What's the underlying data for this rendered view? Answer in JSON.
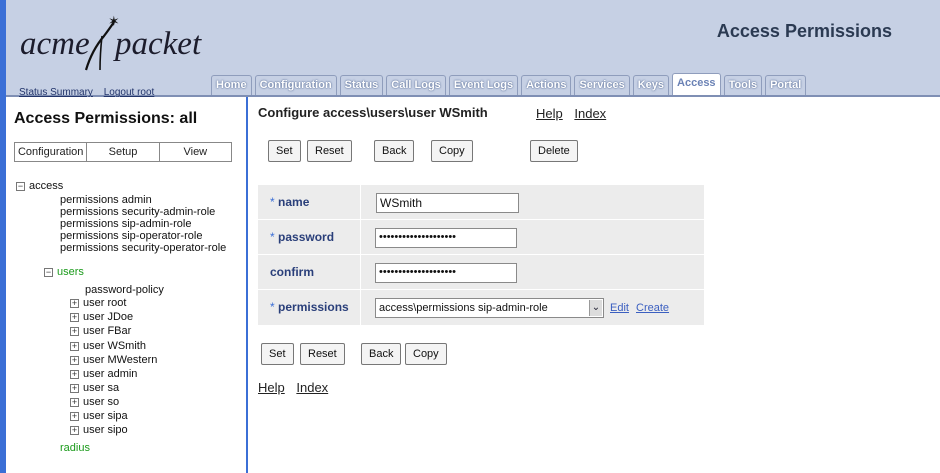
{
  "header": {
    "logo_part1": "acme",
    "logo_part2": "packet",
    "page_heading": "Access Permissions",
    "links": [
      "Status Summary",
      "Logout root"
    ],
    "tabs": [
      "Home",
      "Configuration",
      "Status",
      "Call Logs",
      "Event Logs",
      "Actions",
      "Services",
      "Keys",
      "Access",
      "Tools",
      "Portal"
    ],
    "active_tab": "Access"
  },
  "sidebar": {
    "title": "Access Permissions: all",
    "toggles": [
      "Configuration",
      "Setup",
      "View"
    ],
    "tree": [
      {
        "label": "access",
        "box": "−",
        "color": "black"
      },
      {
        "label": "permissions admin"
      },
      {
        "label": "permissions security-admin-role"
      },
      {
        "label": "permissions sip-admin-role"
      },
      {
        "label": "permissions sip-operator-role"
      },
      {
        "label": "permissions security-operator-role"
      },
      {
        "label": "users",
        "box": "−",
        "color": "green"
      },
      {
        "label": "password-policy"
      },
      {
        "label": "user root",
        "box": "+"
      },
      {
        "label": "user JDoe",
        "box": "+"
      },
      {
        "label": "user FBar",
        "box": "+"
      },
      {
        "label": "user WSmith",
        "box": "+",
        "selected": true
      },
      {
        "label": "user MWestern",
        "box": "+"
      },
      {
        "label": "user admin",
        "box": "+"
      },
      {
        "label": "user sa",
        "box": "+"
      },
      {
        "label": "user so",
        "box": "+"
      },
      {
        "label": "user sipa",
        "box": "+"
      },
      {
        "label": "user sipo",
        "box": "+"
      },
      {
        "label": "radius",
        "color": "green"
      }
    ]
  },
  "main": {
    "title": "Configure access\\users\\user WSmith",
    "title_links": [
      "Help",
      "Index"
    ],
    "buttons_top": [
      "Set",
      "Reset",
      "Back",
      "Copy",
      "Delete"
    ],
    "buttons_bottom": [
      "Set",
      "Reset",
      "Back",
      "Copy"
    ],
    "bottom_links": [
      "Help",
      "Index"
    ],
    "fields": {
      "name_label": "name",
      "name_value": "WSmith",
      "password_label": "password",
      "password_value": "••••••••••••••••••••",
      "confirm_label": "confirm",
      "confirm_value": "••••••••••••••••••••",
      "permissions_label": "permissions",
      "permissions_value": "access\\permissions sip-admin-role",
      "edit_link": "Edit",
      "create_link": "Create",
      "required_mark": "*"
    }
  },
  "colors": {
    "accent": "#3b6fd6",
    "header_bg": "#c6d0e4",
    "tree_green": "#1a9a1a",
    "selected_bg": "#c5cdf3"
  }
}
